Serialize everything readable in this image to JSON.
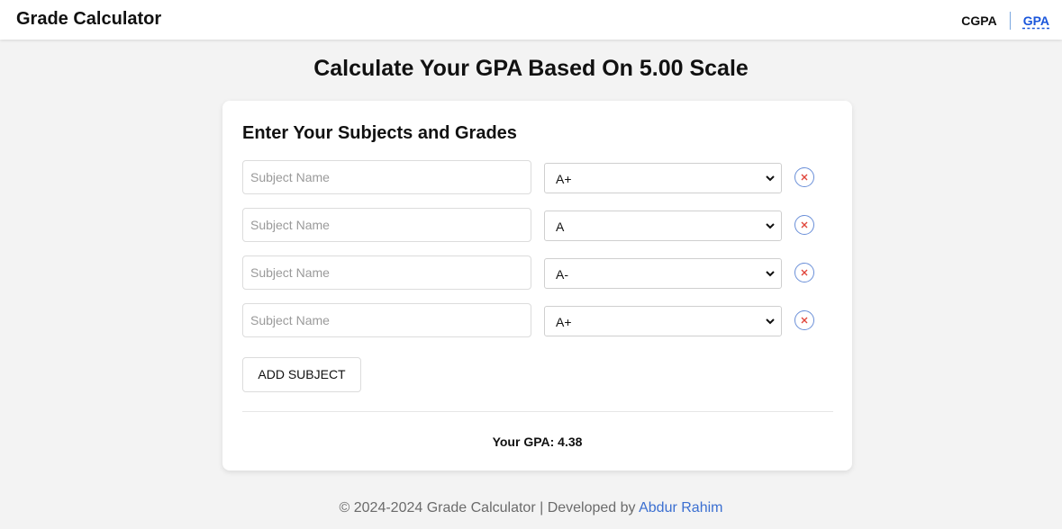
{
  "header": {
    "brand": "Grade Calculator",
    "nav": [
      {
        "label": "CGPA",
        "active": false
      },
      {
        "label": "GPA",
        "active": true
      }
    ]
  },
  "page_title": "Calculate Your GPA Based On 5.00 Scale",
  "card": {
    "title": "Enter Your Subjects and Grades",
    "subject_placeholder": "Subject Name",
    "rows": [
      {
        "subject": "",
        "grade": "A+"
      },
      {
        "subject": "",
        "grade": "A"
      },
      {
        "subject": "",
        "grade": "A-"
      },
      {
        "subject": "",
        "grade": "A+"
      }
    ],
    "add_label": "ADD SUBJECT",
    "result_label": "Your GPA: 4.38"
  },
  "footer": {
    "text": "© 2024-2024 Grade Calculator | Developed by ",
    "author": "Abdur Rahim"
  },
  "colors": {
    "background": "#f3f3f3",
    "card": "#ffffff",
    "link_accent": "#1a56db",
    "remove_icon_border": "#6a8fd8",
    "remove_icon_x": "#e0453a",
    "footer_link": "#3b6fd1"
  },
  "icons": {
    "remove": "close-icon",
    "select": "chevron-down-icon"
  }
}
